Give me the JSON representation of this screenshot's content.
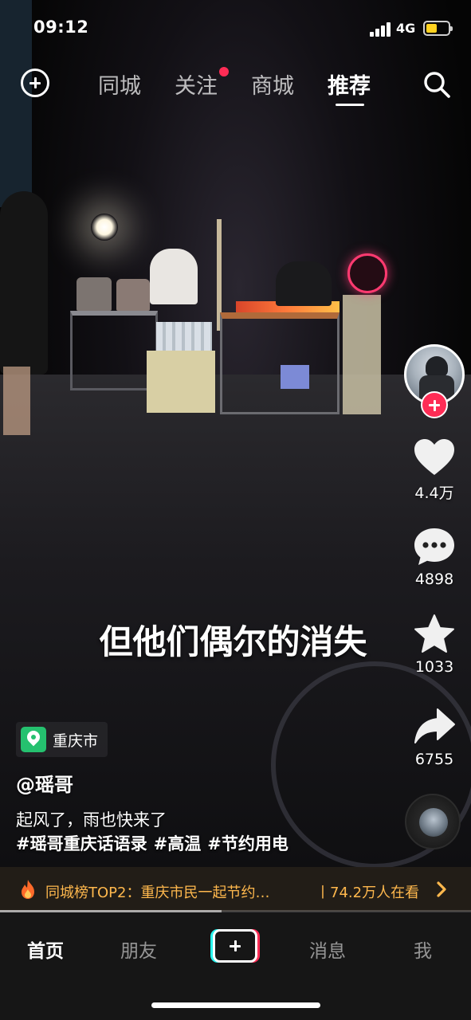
{
  "status_bar": {
    "time": "09:12",
    "network": "4G",
    "battery_level": 0.5,
    "battery_color": "#ffd21f"
  },
  "top_nav": {
    "tabs": [
      {
        "label": "同城"
      },
      {
        "label": "关注"
      },
      {
        "label": "商城"
      },
      {
        "label": "推荐"
      }
    ],
    "active_tab": "推荐",
    "notification_dot_color": "#fe2c55",
    "add_icon": "add-circle-icon",
    "search_icon": "search-icon"
  },
  "video": {
    "subtitle": "但他们偶尔的消失",
    "progress": 0.47
  },
  "actions": {
    "like_count": "4.4万",
    "comment_count": "4898",
    "favorite_count": "1033",
    "share_count": "6755"
  },
  "author": {
    "username": "@瑶哥",
    "location": "重庆市"
  },
  "post": {
    "caption": "起风了，雨也快来了",
    "hashtags": [
      "#瑶哥重庆话语录",
      "#高温",
      "#节约用电"
    ]
  },
  "hot_bar": {
    "title": "同城榜TOP2：重庆市民一起节约…",
    "viewers": "丨74.2万人在看",
    "accent_color": "#ffb84d"
  },
  "bottom_tabs": {
    "home": "首页",
    "friends": "朋友",
    "messages": "消息",
    "me": "我",
    "active": "首页"
  },
  "colors": {
    "brand_red": "#fe2c55",
    "brand_cyan": "#25f4ee",
    "location_green": "#25c16f"
  }
}
